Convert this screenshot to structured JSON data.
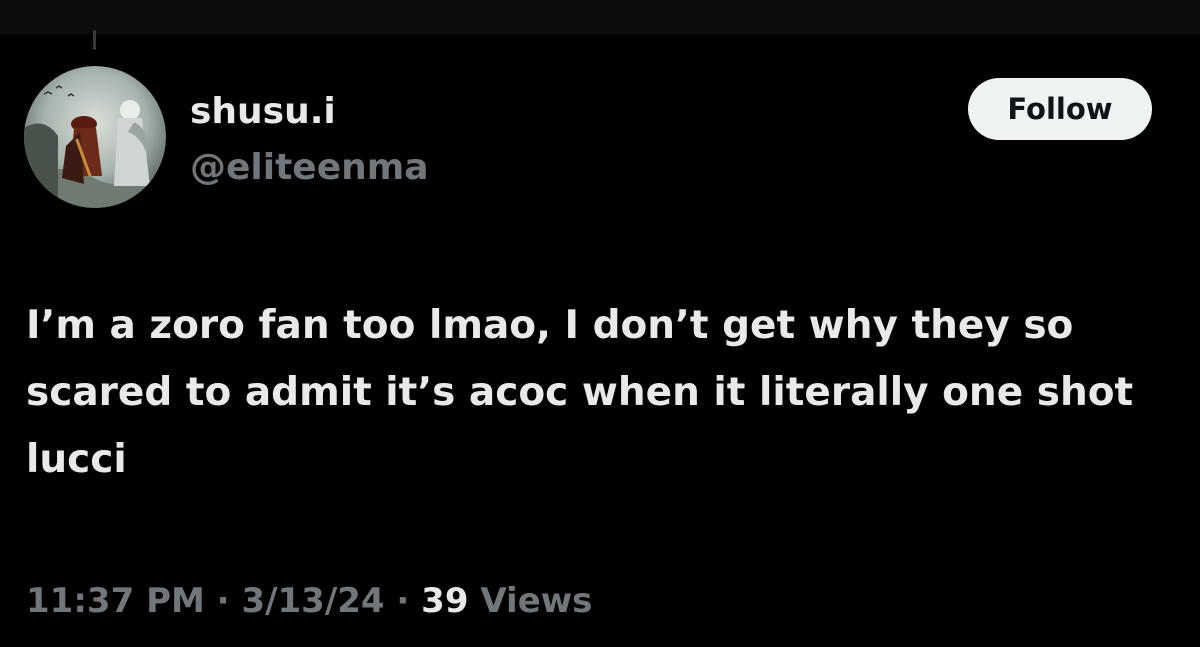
{
  "tweet": {
    "author": {
      "display_name": "shusu.i",
      "handle": "@eliteenma",
      "avatar_icon": "profile-artwork-avatar"
    },
    "follow_label": "Follow",
    "text": "I’m a zoro fan too lmao, I don’t get why they so scared to admit it’s acoc when it literally one shot lucci",
    "time": "11:37 PM",
    "separator": "·",
    "date": "3/13/24",
    "views_count": "39",
    "views_label": "Views"
  },
  "colors": {
    "background": "#000000",
    "primary_text": "#e7e9ea",
    "secondary_text": "#71767b",
    "button_bg": "#eff3f4",
    "button_text": "#0f1419"
  }
}
